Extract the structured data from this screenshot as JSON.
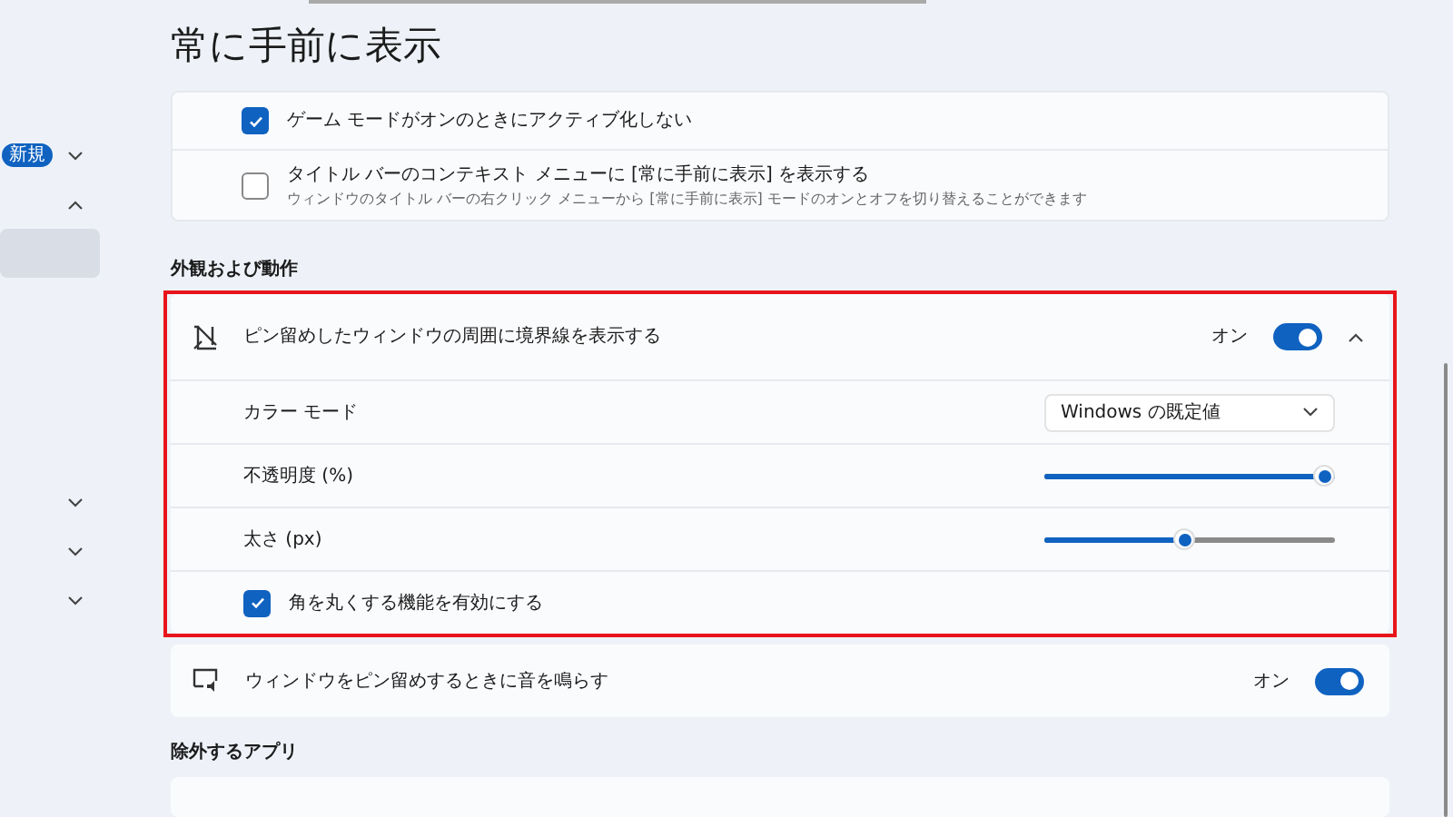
{
  "sidebar": {
    "items": [
      {
        "kind": "badge",
        "badge": "新規",
        "expanded": false,
        "selected": false
      },
      {
        "kind": "plain",
        "expanded": true,
        "selected": false
      },
      {
        "kind": "blank",
        "selected": true
      },
      {
        "kind": "plain",
        "expanded": false,
        "selected": false
      },
      {
        "kind": "plain",
        "expanded": false,
        "selected": false
      },
      {
        "kind": "plain",
        "expanded": false,
        "selected": false
      }
    ]
  },
  "page_title": "常に手前に表示",
  "options": [
    {
      "label": "ゲーム モードがオンのときにアクティブ化しない",
      "checked": true
    },
    {
      "label": "タイトル バーのコンテキスト メニューに [常に手前に表示] を表示する",
      "description": "ウィンドウのタイトル バーの右クリック メニューから [常に手前に表示] モードのオンとオフを切り替えることができます",
      "checked": false
    }
  ],
  "appearance": {
    "heading": "外観および動作",
    "highlighted": true,
    "border_setting": {
      "label": "ピン留めしたウィンドウの周囲に境界線を表示する",
      "state_text": "オン",
      "on": true,
      "expanded": true
    },
    "rows": [
      {
        "kind": "dropdown",
        "label": "カラー モード",
        "value": "Windows の既定値"
      },
      {
        "kind": "slider",
        "label": "不透明度 (%)",
        "level": 1.0
      },
      {
        "kind": "slider",
        "label": "太さ (px)",
        "level": 0.48
      },
      {
        "kind": "checkbox",
        "label": "角を丸くする機能を有効にする",
        "checked": true
      }
    ],
    "sound_setting": {
      "label": "ウィンドウをピン留めするときに音を鳴らす",
      "state_text": "オン",
      "on": true
    }
  },
  "excluded_apps": {
    "heading": "除外するアプリ"
  }
}
